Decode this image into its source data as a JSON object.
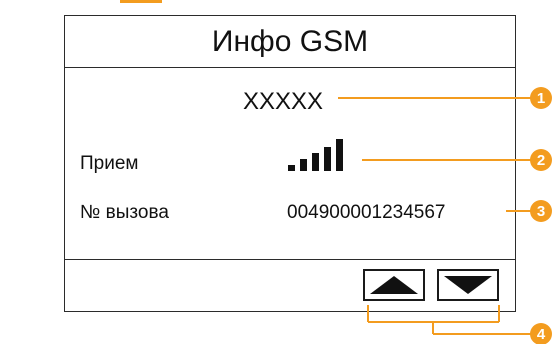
{
  "screen": {
    "title": "Инфо GSM",
    "operator": "XXXXX",
    "reception_label": "Прием",
    "signal_bars": 5,
    "call_number_label": "№ вызова",
    "call_number": "004900001234567"
  },
  "navigation": {
    "up_icon": "arrow-up-icon",
    "down_icon": "arrow-down-icon"
  },
  "callouts": {
    "labels": [
      "1",
      "2",
      "3",
      "4"
    ],
    "color": "#f39c1f"
  }
}
